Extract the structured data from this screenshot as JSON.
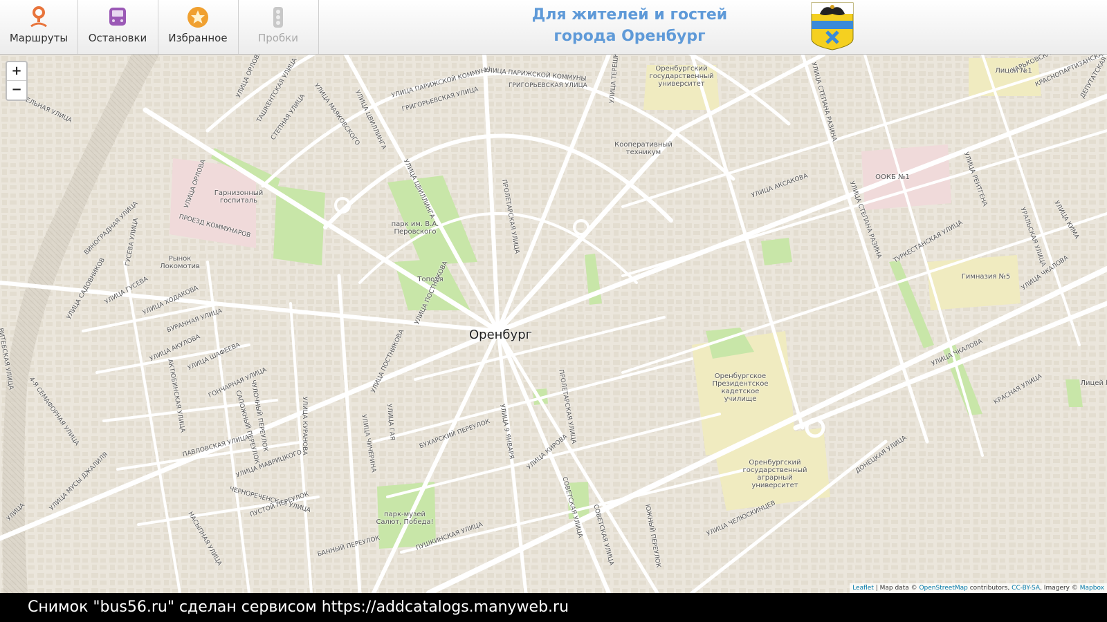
{
  "toolbar": {
    "buttons": [
      {
        "label": "Маршруты",
        "icon": "route-pin-icon",
        "color": "#e8743b"
      },
      {
        "label": "Остановки",
        "icon": "bus-stop-icon",
        "color": "#9b59b6"
      },
      {
        "label": "Избранное",
        "icon": "star-icon",
        "color": "#f0a030"
      },
      {
        "label": "Пробки",
        "icon": "traffic-light-icon",
        "color": "#b0b0b0"
      }
    ],
    "tagline_line1": "Для жителей и гостей",
    "tagline_line2": "города Оренбург",
    "crest": "city-coat-of-arms"
  },
  "map": {
    "zoom_in": "+",
    "zoom_out": "−",
    "city_label": "Оренбург",
    "pois": [
      "Оренбургский государственный университет",
      "Кооперативный техникум",
      "Гарнизонный госпиталь",
      "парк им. В.А. Перовского",
      "Рынок Локомотив",
      "Тополя",
      "ООКБ №1",
      "Гимназия №5",
      "Лицей №1",
      "Лицей №",
      "Оренбургское Президентское кадетское училище",
      "Оренбургский государственный аграрный университет",
      "парк-музей Салют, Победа!"
    ],
    "streets": [
      "УЛИЦА ПАРИЖСКОЙ КОММУНЫ",
      "УЛИЦА ПАРИЖСКОЙ КОММУНЫ",
      "ГРИГОРЬЕВСКАЯ УЛИЦА",
      "ГРИГОРЬЕВСКАЯ УЛИЦА",
      "УЛИЦА ОРЛОВА",
      "ТАШКЕНТСКАЯ УЛИЦА",
      "СТЕПНАЯ УЛИЦА",
      "УЛИЦА МАЯКОВСКОГО",
      "УЛИЦА ЦВИЛЛИНГА",
      "УЛИЦА ЦВИЛЛИНГА",
      "УЛИЦА ТЕРЕШКОВОЙ",
      "УЛИЦА СТЕПАНА РАЗИНА",
      "УЛИЦА СТЕПАНА РАЗИНА",
      "ХАРЬКОВСКАЯ",
      "КРАСНОПАРТИЗАНСКАЯ УЛИЦА",
      "ДЕПУТАТСКАЯ",
      "ШЕВЕЛЬНАЯ УЛИЦА",
      "УЛИЦА ОРЛОВА",
      "ПРОЕЗД КОММУНАРОВ",
      "ВИНОГРАДНАЯ УЛИЦА",
      "УЛИЦА САДОВНИКОВ",
      "ГУСЕВА УЛИЦА",
      "УЛИЦА ГУСЕВА",
      "УЛИЦА ХОДАКОВА",
      "БУРАННАЯ УЛИЦА",
      "УЛИЦА АКУЛОВА",
      "УЛИЦА ШАФЕЕВА",
      "АКТЮБИНСКАЯ УЛИЦА",
      "ГОНЧАРНАЯ УЛИЦА",
      "САПОЖНЫЙ ПЕРЕУЛОК",
      "ЧУЛОЧНЫЙ ПЕРЕУЛОК",
      "УЛИЦА КУРАНОВА",
      "ПАВЛОВСКАЯ УЛИЦА",
      "УЛИЦА МАВРИЦКОГО",
      "ЧЕРНОРЕЧЕНСКАЯ УЛИЦА",
      "ПУСТОЙ ПЕРЕУЛОК",
      "НАСЫПНАЯ УЛИЦА",
      "БАННЫЙ ПЕРЕУЛОК",
      "ВИТЕБСКАЯ УЛИЦА",
      "4-Я СЕМАФОРНАЯ УЛИЦА",
      "УЛИЦА МУСЫ ДЖАЛИЛЯ",
      "УЛИЦА",
      "УЛИЦА ПОСТНИКОВА",
      "УЛИЦА ПОСТНИКОВА",
      "УЛИЦА ЧИЧЕРИНА",
      "УЛИЦА ГАЯ",
      "БУХАРСКИЙ ПЕРЕУЛОК",
      "УЛИЦА 9 ЯНВАРЯ",
      "УЛИЦА КИРОВА",
      "ПРОЛЕТАРСКАЯ УЛИЦА",
      "ПРОЛЕТАРСКАЯ УЛИЦА",
      "СОВЕТСКАЯ УЛИЦА",
      "СОВЕТСКАЯ УЛИЦА",
      "ЮЖНЫЙ ПЕРЕУЛОК",
      "ПУШКИНСКАЯ УЛИЦА",
      "УЛИЦА АКСАКОВА",
      "ТУРКЕСТАНСКАЯ УЛИЦА",
      "УЛИЦА РЕНТГЕНА",
      "УРАЛЬСКАЯ УЛИЦА",
      "УЛИЦА КИМА",
      "УЛИЦА ЧКАЛОВА",
      "УЛИЦА ЧКАЛОВА",
      "КРАСНАЯ УЛИЦА",
      "ДОНЕЦКАЯ УЛИЦА",
      "УЛИЦА ЧЕЛЮСКИНЦЕВ"
    ],
    "attribution": {
      "leaflet": "Leaflet",
      "map_data": " | Map data © ",
      "osm": "OpenStreetMap",
      "contributors": " contributors, ",
      "license": "CC-BY-SA",
      "imagery": ", Imagery © ",
      "provider": "Mapbox"
    }
  },
  "caption": "Снимок \"bus56.ru\" сделан сервисом https://addcatalogs.manyweb.ru",
  "colors": {
    "map_bg": "#ebe6dc",
    "park": "#c8e6a8",
    "campus": "#f0ebc0",
    "hospital": "#f0dada",
    "tagline": "#5f9ad8"
  }
}
